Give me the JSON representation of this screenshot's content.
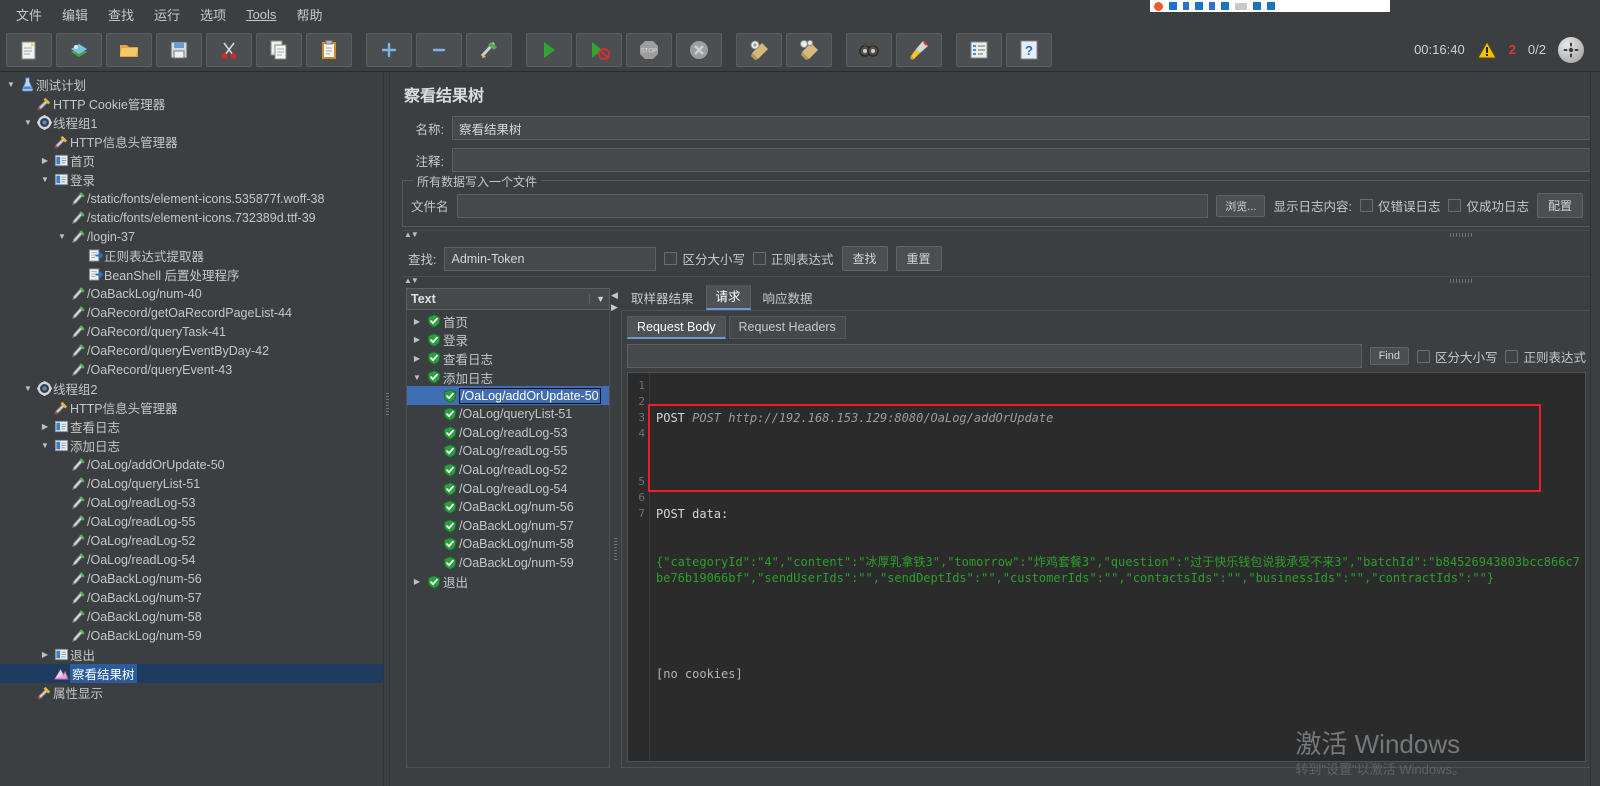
{
  "menubar": {
    "items": [
      {
        "label": "文件"
      },
      {
        "label": "编辑"
      },
      {
        "label": "查找"
      },
      {
        "label": "运行"
      },
      {
        "label": "选项"
      },
      {
        "label": "Tools"
      },
      {
        "label": "帮助"
      }
    ]
  },
  "toolbar": {
    "buttons": [
      {
        "name": "new-button",
        "icon": "new-document-icon"
      },
      {
        "name": "templates-button",
        "icon": "templates-icon"
      },
      {
        "name": "open-button",
        "icon": "open-folder-icon"
      },
      {
        "name": "save-button",
        "icon": "save-disk-icon"
      },
      {
        "name": "cut-button",
        "icon": "scissors-icon"
      },
      {
        "name": "copy-button",
        "icon": "copy-icon"
      },
      {
        "name": "paste-button",
        "icon": "clipboard-icon"
      },
      {
        "name": "expand-button",
        "icon": "plus-icon"
      },
      {
        "name": "collapse-button",
        "icon": "minus-icon"
      },
      {
        "name": "toggle-button",
        "icon": "toggle-icon"
      },
      {
        "name": "start-button",
        "icon": "play-icon"
      },
      {
        "name": "start-no-pause-button",
        "icon": "play-no-timers-icon"
      },
      {
        "name": "stop-button",
        "icon": "stop-icon"
      },
      {
        "name": "shutdown-button",
        "icon": "shutdown-icon"
      },
      {
        "name": "clear-button",
        "icon": "clear-icon"
      },
      {
        "name": "clear-all-button",
        "icon": "clear-all-icon"
      },
      {
        "name": "search-button",
        "icon": "binoculars-icon"
      },
      {
        "name": "reset-search-button",
        "icon": "broom-icon"
      },
      {
        "name": "function-helper-button",
        "icon": "list-icon"
      },
      {
        "name": "help-button",
        "icon": "help-icon"
      }
    ],
    "status": {
      "elapsed": "00:16:40",
      "warning_count": "2",
      "threads": "0/2"
    }
  },
  "tree": {
    "nodes": [
      {
        "label": "测试计划",
        "depth": 0,
        "twist": "down",
        "icon": "test-plan-icon",
        "selected": false
      },
      {
        "label": "HTTP Cookie管理器",
        "depth": 1,
        "twist": "none",
        "icon": "config-wrench-icon",
        "selected": false
      },
      {
        "label": "线程组1",
        "depth": 1,
        "twist": "down",
        "icon": "thread-group-icon",
        "selected": false
      },
      {
        "label": "HTTP信息头管理器",
        "depth": 2,
        "twist": "none",
        "icon": "config-wrench-icon",
        "selected": false
      },
      {
        "label": "首页",
        "depth": 2,
        "twist": "right",
        "icon": "controller-icon",
        "selected": false
      },
      {
        "label": "登录",
        "depth": 2,
        "twist": "down",
        "icon": "controller-icon",
        "selected": false
      },
      {
        "label": "/static/fonts/element-icons.535877f.woff-38",
        "depth": 3,
        "twist": "none",
        "icon": "http-sampler-icon",
        "selected": false
      },
      {
        "label": "/static/fonts/element-icons.732389d.ttf-39",
        "depth": 3,
        "twist": "none",
        "icon": "http-sampler-icon",
        "selected": false
      },
      {
        "label": "/login-37",
        "depth": 3,
        "twist": "down",
        "icon": "http-sampler-icon",
        "selected": false
      },
      {
        "label": "正则表达式提取器",
        "depth": 4,
        "twist": "none",
        "icon": "post-processor-icon",
        "selected": false
      },
      {
        "label": "BeanShell 后置处理程序",
        "depth": 4,
        "twist": "none",
        "icon": "post-processor-icon",
        "selected": false
      },
      {
        "label": "/OaBackLog/num-40",
        "depth": 3,
        "twist": "none",
        "icon": "http-sampler-icon",
        "selected": false
      },
      {
        "label": "/OaRecord/getOaRecordPageList-44",
        "depth": 3,
        "twist": "none",
        "icon": "http-sampler-icon",
        "selected": false
      },
      {
        "label": "/OaRecord/queryTask-41",
        "depth": 3,
        "twist": "none",
        "icon": "http-sampler-icon",
        "selected": false
      },
      {
        "label": "/OaRecord/queryEventByDay-42",
        "depth": 3,
        "twist": "none",
        "icon": "http-sampler-icon",
        "selected": false
      },
      {
        "label": "/OaRecord/queryEvent-43",
        "depth": 3,
        "twist": "none",
        "icon": "http-sampler-icon",
        "selected": false
      },
      {
        "label": "线程组2",
        "depth": 1,
        "twist": "down",
        "icon": "thread-group-icon",
        "selected": false
      },
      {
        "label": "HTTP信息头管理器",
        "depth": 2,
        "twist": "none",
        "icon": "config-wrench-icon",
        "selected": false
      },
      {
        "label": "查看日志",
        "depth": 2,
        "twist": "right",
        "icon": "controller-icon",
        "selected": false
      },
      {
        "label": "添加日志",
        "depth": 2,
        "twist": "down",
        "icon": "controller-icon",
        "selected": false
      },
      {
        "label": "/OaLog/addOrUpdate-50",
        "depth": 3,
        "twist": "none",
        "icon": "http-sampler-icon",
        "selected": false
      },
      {
        "label": "/OaLog/queryList-51",
        "depth": 3,
        "twist": "none",
        "icon": "http-sampler-icon",
        "selected": false
      },
      {
        "label": "/OaLog/readLog-53",
        "depth": 3,
        "twist": "none",
        "icon": "http-sampler-icon",
        "selected": false
      },
      {
        "label": "/OaLog/readLog-55",
        "depth": 3,
        "twist": "none",
        "icon": "http-sampler-icon",
        "selected": false
      },
      {
        "label": "/OaLog/readLog-52",
        "depth": 3,
        "twist": "none",
        "icon": "http-sampler-icon",
        "selected": false
      },
      {
        "label": "/OaLog/readLog-54",
        "depth": 3,
        "twist": "none",
        "icon": "http-sampler-icon",
        "selected": false
      },
      {
        "label": "/OaBackLog/num-56",
        "depth": 3,
        "twist": "none",
        "icon": "http-sampler-icon",
        "selected": false
      },
      {
        "label": "/OaBackLog/num-57",
        "depth": 3,
        "twist": "none",
        "icon": "http-sampler-icon",
        "selected": false
      },
      {
        "label": "/OaBackLog/num-58",
        "depth": 3,
        "twist": "none",
        "icon": "http-sampler-icon",
        "selected": false
      },
      {
        "label": "/OaBackLog/num-59",
        "depth": 3,
        "twist": "none",
        "icon": "http-sampler-icon",
        "selected": false
      },
      {
        "label": "退出",
        "depth": 2,
        "twist": "right",
        "icon": "controller-icon",
        "selected": false
      },
      {
        "label": "察看结果树",
        "depth": 2,
        "twist": "none",
        "icon": "view-results-tree-icon",
        "selected": true
      },
      {
        "label": "属性显示",
        "depth": 1,
        "twist": "none",
        "icon": "config-wrench-icon",
        "selected": false
      }
    ]
  },
  "panel": {
    "title": "察看结果树",
    "name_label": "名称:",
    "name_value": "察看结果树",
    "comment_label": "注释:",
    "comment_value": "",
    "group_title": "所有数据写入一个文件",
    "filename_label": "文件名",
    "filename_value": "",
    "browse_label": "浏览...",
    "log_display_label": "显示日志内容:",
    "errors_only_label": "仅错误日志",
    "success_only_label": "仅成功日志",
    "configure_label": "配置"
  },
  "search": {
    "label": "查找:",
    "value": "Admin-Token",
    "case_label": "区分大小写",
    "regex_label": "正则表达式",
    "find_label": "查找",
    "reset_label": "重置"
  },
  "results": {
    "renderer": "Text",
    "nodes": [
      {
        "label": "首页",
        "depth": 0,
        "twist": "right",
        "selected": false
      },
      {
        "label": "登录",
        "depth": 0,
        "twist": "right",
        "selected": false
      },
      {
        "label": "查看日志",
        "depth": 0,
        "twist": "right",
        "selected": false
      },
      {
        "label": "添加日志",
        "depth": 0,
        "twist": "down",
        "selected": false
      },
      {
        "label": "/OaLog/addOrUpdate-50",
        "depth": 1,
        "twist": "none",
        "selected": true
      },
      {
        "label": "/OaLog/queryList-51",
        "depth": 1,
        "twist": "none",
        "selected": false
      },
      {
        "label": "/OaLog/readLog-53",
        "depth": 1,
        "twist": "none",
        "selected": false
      },
      {
        "label": "/OaLog/readLog-55",
        "depth": 1,
        "twist": "none",
        "selected": false
      },
      {
        "label": "/OaLog/readLog-52",
        "depth": 1,
        "twist": "none",
        "selected": false
      },
      {
        "label": "/OaLog/readLog-54",
        "depth": 1,
        "twist": "none",
        "selected": false
      },
      {
        "label": "/OaBackLog/num-56",
        "depth": 1,
        "twist": "none",
        "selected": false
      },
      {
        "label": "/OaBackLog/num-57",
        "depth": 1,
        "twist": "none",
        "selected": false
      },
      {
        "label": "/OaBackLog/num-58",
        "depth": 1,
        "twist": "none",
        "selected": false
      },
      {
        "label": "/OaBackLog/num-59",
        "depth": 1,
        "twist": "none",
        "selected": false
      },
      {
        "label": "退出",
        "depth": 0,
        "twist": "right",
        "selected": false
      }
    ]
  },
  "viewer": {
    "tabs": [
      {
        "label": "取样器结果",
        "selected": false
      },
      {
        "label": "请求",
        "selected": true
      },
      {
        "label": "响应数据",
        "selected": false
      }
    ],
    "subtabs": [
      {
        "label": "Request Body",
        "selected": true
      },
      {
        "label": "Request Headers",
        "selected": false
      }
    ],
    "find": {
      "value": "",
      "find_label": "Find",
      "case_label": "区分大小写",
      "regex_label": "正则表达式"
    },
    "body": {
      "line1": "POST http://192.168.153.129:8080/OaLog/addOrUpdate",
      "line3": "POST data:",
      "line4": "{\"categoryId\":\"4\",\"content\":\"冰厚乳拿铁3\",\"tomorrow\":\"炸鸡套餐3\",\"question\":\"过于快乐钱包说我承受不来3\",\"batchId\":\"b84526943803bcc866c7be76b19066bf\",\"sendUserIds\":\"\",\"sendDeptIds\":\"\",\"customerIds\":\"\",\"contactsIds\":\"\",\"businessIds\":\"\",\"contractIds\":\"\"}",
      "line6": "[no cookies]",
      "line_numbers": [
        "1",
        "2",
        "3",
        "4",
        "5",
        "6",
        "7"
      ]
    }
  },
  "watermark": {
    "line1": "激活 Windows",
    "line2": "转到\"设置\"以激活 Windows。"
  },
  "colors": {
    "accent": "#6d9ad6",
    "selection": "#3f6eb5",
    "json_green": "#2aa02a",
    "error_red": "#d8372d",
    "redbox": "#ee1c25"
  }
}
